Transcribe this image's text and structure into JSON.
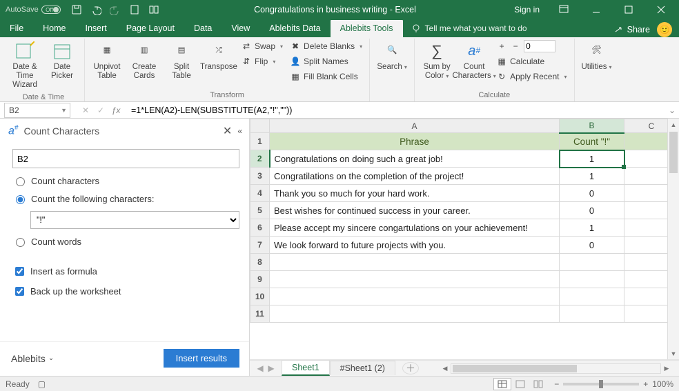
{
  "title_bar": {
    "autosave_label": "AutoSave",
    "autosave_state": "Off",
    "doc_title": "Congratulations in business writing  -  Excel",
    "sign_in": "Sign in"
  },
  "tabs": {
    "file": "File",
    "home": "Home",
    "insert": "Insert",
    "page_layout": "Page Layout",
    "data": "Data",
    "view": "View",
    "ablebits_data": "Ablebits Data",
    "ablebits_tools": "Ablebits Tools",
    "tell_me": "Tell me what you want to do",
    "share": "Share"
  },
  "ribbon": {
    "date_time": {
      "wizard": "Date & Time Wizard",
      "picker": "Date Picker",
      "group": "Date & Time"
    },
    "transform": {
      "unpivot": "Unpivot Table",
      "create_cards": "Create Cards",
      "split_table": "Split Table",
      "transpose": "Transpose",
      "swap": "Swap",
      "flip": "Flip",
      "delete_blanks": "Delete Blanks",
      "split_names": "Split Names",
      "fill_blank": "Fill Blank Cells",
      "group": "Transform"
    },
    "search": {
      "btn": "Search"
    },
    "calculate": {
      "sum_color": "Sum by Color",
      "count_chars": "Count Characters",
      "calculate": "Calculate",
      "apply_recent": "Apply Recent",
      "group": "Calculate"
    },
    "utilities": "Utilities"
  },
  "fx": {
    "name_box": "B2",
    "formula": "=1*LEN(A2)-LEN(SUBSTITUTE(A2,\"!\",\"\"))"
  },
  "panel": {
    "title": "Count Characters",
    "range": "B2",
    "opt_count_chars": "Count characters",
    "opt_count_following": "Count the following characters:",
    "selected_char": "\"!\"",
    "opt_count_words": "Count words",
    "chk_formula": "Insert as formula",
    "chk_backup": "Back up the worksheet",
    "brand": "Ablebits",
    "insert_btn": "Insert results"
  },
  "sheet": {
    "col_A_header": "Phrase",
    "col_B_header": "Count \"!\"",
    "rows": [
      {
        "a": "Congratulations on doing such a great job!",
        "b": "1"
      },
      {
        "a": "Congratilations on the completion of the project!",
        "b": "1"
      },
      {
        "a": "Thank you so much for your hard work.",
        "b": "0"
      },
      {
        "a": "Best wishes for continued success in your career.",
        "b": "0"
      },
      {
        "a": "Please accept my sincere congartulations on your achievement!",
        "b": "1"
      },
      {
        "a": "We look forward to future projects with you.",
        "b": "0"
      }
    ]
  },
  "sheet_tabs": {
    "active": "Sheet1",
    "other": "#Sheet1 (2)"
  },
  "status": {
    "ready": "Ready",
    "zoom": "100%"
  },
  "colors": {
    "excel_green": "#217346",
    "blue_btn": "#2b7cd3",
    "header_row_bg": "#d4e5c4"
  }
}
